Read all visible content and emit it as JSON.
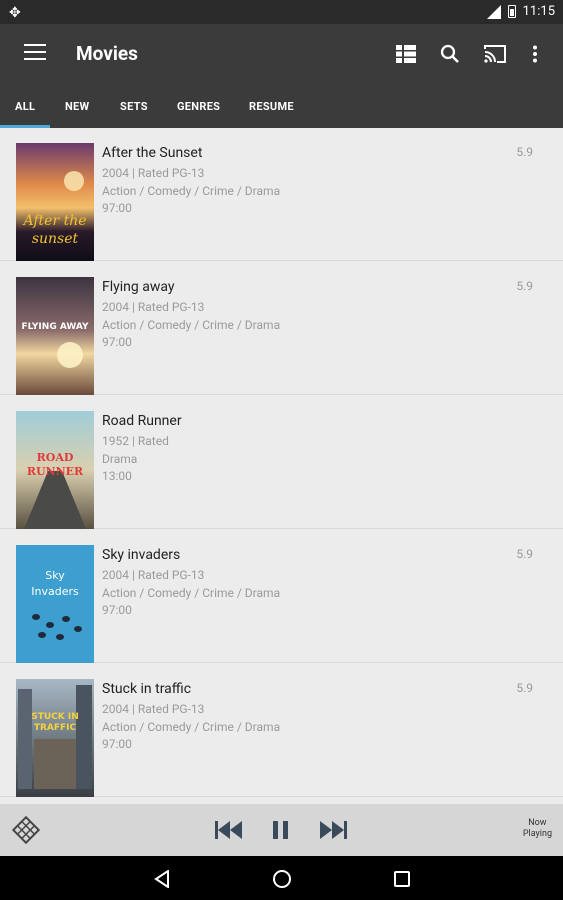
{
  "status_bar": {
    "time": "11:15"
  },
  "appbar": {
    "title": "Movies"
  },
  "tabs": [
    {
      "label": "ALL"
    },
    {
      "label": "NEW"
    },
    {
      "label": "SETS"
    },
    {
      "label": "GENRES"
    },
    {
      "label": "RESUME"
    }
  ],
  "movies": [
    {
      "title": "After the Sunset",
      "info": "2004 | Rated PG-13",
      "genres": "Action / Comedy / Crime / Drama",
      "runtime": "97:00",
      "rating": "5.9",
      "poster_text": "After the sunset"
    },
    {
      "title": "Flying away",
      "info": "2004 | Rated PG-13",
      "genres": "Action / Comedy / Crime / Drama",
      "runtime": "97:00",
      "rating": "5.9",
      "poster_text": "FLYING AWAY"
    },
    {
      "title": "Road Runner",
      "info": "1952 | Rated",
      "genres": "Drama",
      "runtime": "13:00",
      "rating": "",
      "poster_text": "ROAD RUNNER"
    },
    {
      "title": "Sky invaders",
      "info": "2004 | Rated PG-13",
      "genres": "Action / Comedy / Crime / Drama",
      "runtime": "97:00",
      "rating": "5.9",
      "poster_text": "Sky Invaders"
    },
    {
      "title": "Stuck in traffic",
      "info": "2004 | Rated PG-13",
      "genres": "Action / Comedy / Crime / Drama",
      "runtime": "97:00",
      "rating": "5.9",
      "poster_text": "STUCK IN TRAFFIC"
    }
  ],
  "player": {
    "now_playing_line1": "Now",
    "now_playing_line2": "Playing"
  },
  "colors": {
    "appbar": "#3b3b3b",
    "status_bar": "#2a2a2a",
    "tab_indicator": "#4ea8d8",
    "background": "#ececec",
    "player": "#d6d6d6"
  }
}
